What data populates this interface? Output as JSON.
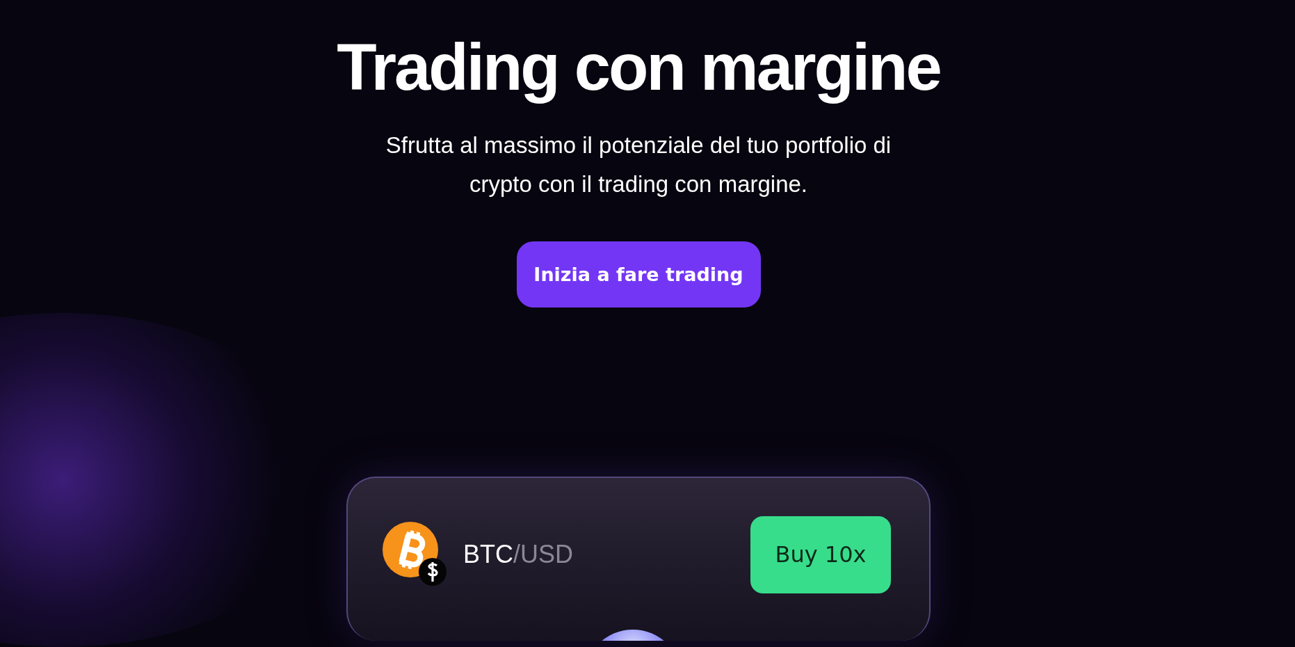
{
  "hero": {
    "title": "Trading con margine",
    "subtitle": "Sfrutta al massimo il potenziale del tuo portfolio di crypto con il trading con margine.",
    "cta": "Inizia a fare trading"
  },
  "trade_card": {
    "base": "BTC",
    "separator": "/",
    "quote": "USD",
    "action": "Buy 10x"
  }
}
